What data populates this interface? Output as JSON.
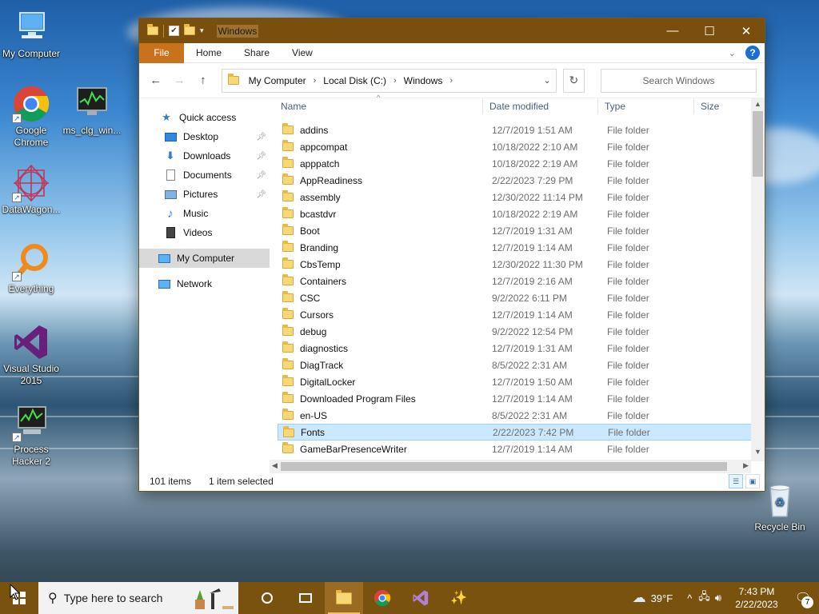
{
  "desktop": {
    "icons": [
      {
        "label": "My Computer",
        "icon": "computer-icon"
      },
      {
        "label": "Google Chrome",
        "icon": "chrome-icon"
      },
      {
        "label": "ms_clg_win...",
        "icon": "monitor-graph-icon"
      },
      {
        "label": "DataWagon...",
        "icon": "datawagon-icon"
      },
      {
        "label": "Everything",
        "icon": "everything-search-icon"
      },
      {
        "label": "Visual Studio 2015",
        "icon": "visual-studio-icon"
      },
      {
        "label": "Process Hacker 2",
        "icon": "process-hacker-icon"
      },
      {
        "label": "Recycle Bin",
        "icon": "recycle-bin-icon"
      }
    ]
  },
  "window": {
    "title": "Windows",
    "controls": {
      "minimize": "—",
      "maximize": "☐",
      "close": "✕"
    },
    "ribbon": {
      "file": "File",
      "tabs": [
        "Home",
        "Share",
        "View"
      ]
    },
    "address": {
      "crumbs": [
        "My Computer",
        "Local Disk (C:)",
        "Windows"
      ]
    },
    "search_placeholder": "Search Windows",
    "nav": {
      "quick_access": "Quick access",
      "quick_items": [
        {
          "label": "Desktop",
          "icon": "desktop-icon",
          "pinned": true
        },
        {
          "label": "Downloads",
          "icon": "download-icon",
          "pinned": true
        },
        {
          "label": "Documents",
          "icon": "documents-icon",
          "pinned": true
        },
        {
          "label": "Pictures",
          "icon": "pictures-icon",
          "pinned": true
        },
        {
          "label": "Music",
          "icon": "music-icon",
          "pinned": false
        },
        {
          "label": "Videos",
          "icon": "videos-icon",
          "pinned": false
        }
      ],
      "my_computer": "My Computer",
      "network": "Network"
    },
    "columns": {
      "name": "Name",
      "date": "Date modified",
      "type": "Type",
      "size": "Size"
    },
    "files": [
      {
        "name": "addins",
        "date": "12/7/2019 1:51 AM",
        "type": "File folder"
      },
      {
        "name": "appcompat",
        "date": "10/18/2022 2:10 AM",
        "type": "File folder"
      },
      {
        "name": "apppatch",
        "date": "10/18/2022 2:19 AM",
        "type": "File folder"
      },
      {
        "name": "AppReadiness",
        "date": "2/22/2023 7:29 PM",
        "type": "File folder"
      },
      {
        "name": "assembly",
        "date": "12/30/2022 11:14 PM",
        "type": "File folder"
      },
      {
        "name": "bcastdvr",
        "date": "10/18/2022 2:19 AM",
        "type": "File folder"
      },
      {
        "name": "Boot",
        "date": "12/7/2019 1:31 AM",
        "type": "File folder"
      },
      {
        "name": "Branding",
        "date": "12/7/2019 1:14 AM",
        "type": "File folder"
      },
      {
        "name": "CbsTemp",
        "date": "12/30/2022 11:30 PM",
        "type": "File folder"
      },
      {
        "name": "Containers",
        "date": "12/7/2019 2:16 AM",
        "type": "File folder"
      },
      {
        "name": "CSC",
        "date": "9/2/2022 6:11 PM",
        "type": "File folder"
      },
      {
        "name": "Cursors",
        "date": "12/7/2019 1:14 AM",
        "type": "File folder"
      },
      {
        "name": "debug",
        "date": "9/2/2022 12:54 PM",
        "type": "File folder"
      },
      {
        "name": "diagnostics",
        "date": "12/7/2019 1:31 AM",
        "type": "File folder"
      },
      {
        "name": "DiagTrack",
        "date": "8/5/2022 2:31 AM",
        "type": "File folder"
      },
      {
        "name": "DigitalLocker",
        "date": "12/7/2019 1:50 AM",
        "type": "File folder"
      },
      {
        "name": "Downloaded Program Files",
        "date": "12/7/2019 1:14 AM",
        "type": "File folder"
      },
      {
        "name": "en-US",
        "date": "8/5/2022 2:31 AM",
        "type": "File folder"
      },
      {
        "name": "Fonts",
        "date": "2/22/2023 7:42 PM",
        "type": "File folder",
        "selected": true
      },
      {
        "name": "GameBarPresenceWriter",
        "date": "12/7/2019 1:14 AM",
        "type": "File folder"
      }
    ],
    "status": {
      "items": "101 items",
      "selection": "1 item selected"
    }
  },
  "taskbar": {
    "search_placeholder": "Type here to search",
    "weather": "39°F",
    "time": "7:43 PM",
    "date": "2/22/2023",
    "notifications": "7"
  },
  "colors": {
    "accent": "#7a520f",
    "file_tab": "#c8721c",
    "selection": "#cce8ff",
    "folder": "#f8d775"
  }
}
